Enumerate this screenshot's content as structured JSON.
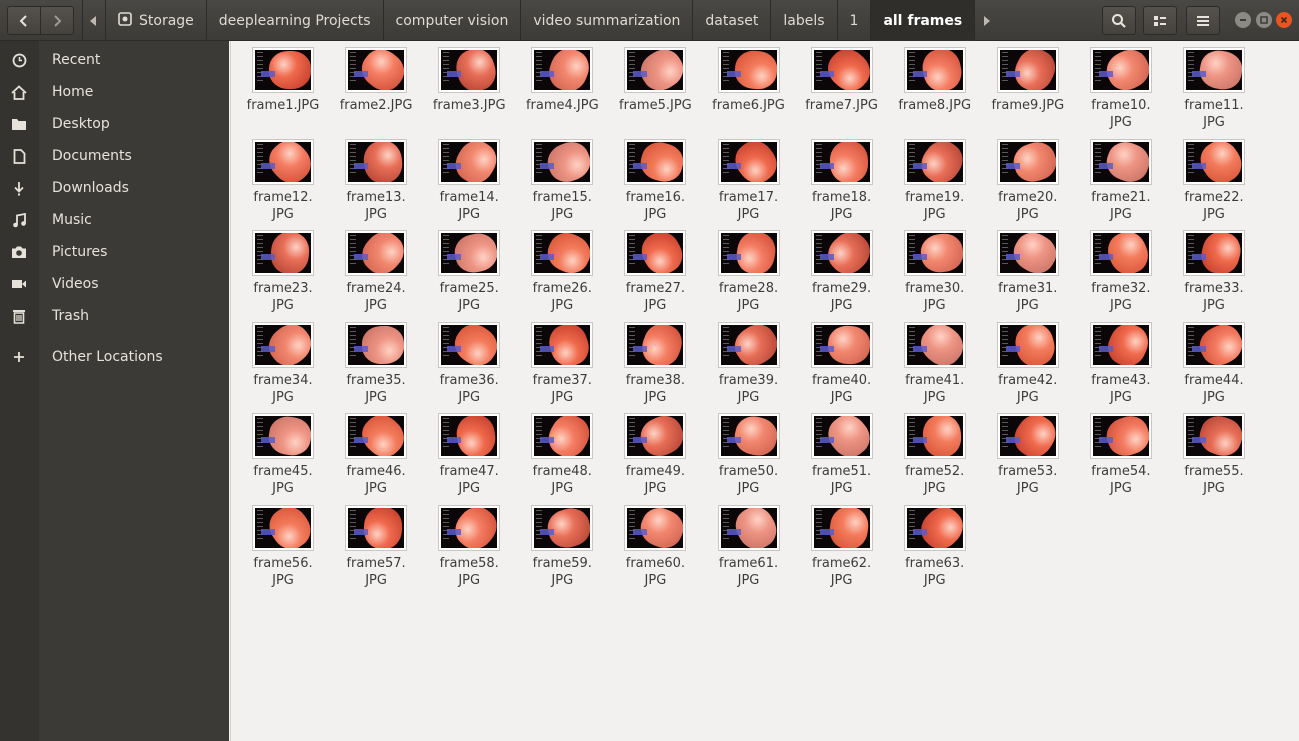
{
  "breadcrumbs": [
    {
      "label": "Storage",
      "icon": "drive-icon"
    },
    {
      "label": "deeplearning Projects"
    },
    {
      "label": "computer vision"
    },
    {
      "label": "video summarization"
    },
    {
      "label": "dataset"
    },
    {
      "label": "labels"
    },
    {
      "label": "1"
    },
    {
      "label": "all frames",
      "active": true
    }
  ],
  "sidebar": {
    "items": [
      {
        "label": "Recent",
        "icon": "clock-icon"
      },
      {
        "label": "Home",
        "icon": "home-icon"
      },
      {
        "label": "Desktop",
        "icon": "folder-icon"
      },
      {
        "label": "Documents",
        "icon": "document-icon"
      },
      {
        "label": "Downloads",
        "icon": "download-icon"
      },
      {
        "label": "Music",
        "icon": "music-icon"
      },
      {
        "label": "Pictures",
        "icon": "camera-icon"
      },
      {
        "label": "Videos",
        "icon": "video-icon"
      },
      {
        "label": "Trash",
        "icon": "trash-icon"
      },
      {
        "label": "Other Locations",
        "icon": "plus-icon"
      }
    ]
  },
  "colors": {
    "header_bg": "#3d3b37",
    "sidebar_bg": "#3b3a37",
    "content_bg": "#f2f1f0",
    "close_button": "#e95420",
    "window_button": "#8b8a85"
  },
  "files": [
    {
      "line1": "frame1.JPG",
      "line2": ""
    },
    {
      "line1": "frame2.JPG",
      "line2": ""
    },
    {
      "line1": "frame3.JPG",
      "line2": ""
    },
    {
      "line1": "frame4.JPG",
      "line2": ""
    },
    {
      "line1": "frame5.JPG",
      "line2": ""
    },
    {
      "line1": "frame6.JPG",
      "line2": ""
    },
    {
      "line1": "frame7.JPG",
      "line2": ""
    },
    {
      "line1": "frame8.JPG",
      "line2": ""
    },
    {
      "line1": "frame9.JPG",
      "line2": ""
    },
    {
      "line1": "frame10.",
      "line2": "JPG"
    },
    {
      "line1": "frame11.",
      "line2": "JPG"
    },
    {
      "line1": "frame12.",
      "line2": "JPG"
    },
    {
      "line1": "frame13.",
      "line2": "JPG"
    },
    {
      "line1": "frame14.",
      "line2": "JPG"
    },
    {
      "line1": "frame15.",
      "line2": "JPG"
    },
    {
      "line1": "frame16.",
      "line2": "JPG"
    },
    {
      "line1": "frame17.",
      "line2": "JPG"
    },
    {
      "line1": "frame18.",
      "line2": "JPG"
    },
    {
      "line1": "frame19.",
      "line2": "JPG"
    },
    {
      "line1": "frame20.",
      "line2": "JPG"
    },
    {
      "line1": "frame21.",
      "line2": "JPG"
    },
    {
      "line1": "frame22.",
      "line2": "JPG"
    },
    {
      "line1": "frame23.",
      "line2": "JPG"
    },
    {
      "line1": "frame24.",
      "line2": "JPG"
    },
    {
      "line1": "frame25.",
      "line2": "JPG"
    },
    {
      "line1": "frame26.",
      "line2": "JPG"
    },
    {
      "line1": "frame27.",
      "line2": "JPG"
    },
    {
      "line1": "frame28.",
      "line2": "JPG"
    },
    {
      "line1": "frame29.",
      "line2": "JPG"
    },
    {
      "line1": "frame30.",
      "line2": "JPG"
    },
    {
      "line1": "frame31.",
      "line2": "JPG"
    },
    {
      "line1": "frame32.",
      "line2": "JPG"
    },
    {
      "line1": "frame33.",
      "line2": "JPG"
    },
    {
      "line1": "frame34.",
      "line2": "JPG"
    },
    {
      "line1": "frame35.",
      "line2": "JPG"
    },
    {
      "line1": "frame36.",
      "line2": "JPG"
    },
    {
      "line1": "frame37.",
      "line2": "JPG"
    },
    {
      "line1": "frame38.",
      "line2": "JPG"
    },
    {
      "line1": "frame39.",
      "line2": "JPG"
    },
    {
      "line1": "frame40.",
      "line2": "JPG"
    },
    {
      "line1": "frame41.",
      "line2": "JPG"
    },
    {
      "line1": "frame42.",
      "line2": "JPG"
    },
    {
      "line1": "frame43.",
      "line2": "JPG"
    },
    {
      "line1": "frame44.",
      "line2": "JPG"
    },
    {
      "line1": "frame45.",
      "line2": "JPG"
    },
    {
      "line1": "frame46.",
      "line2": "JPG"
    },
    {
      "line1": "frame47.",
      "line2": "JPG"
    },
    {
      "line1": "frame48.",
      "line2": "JPG"
    },
    {
      "line1": "frame49.",
      "line2": "JPG"
    },
    {
      "line1": "frame50.",
      "line2": "JPG"
    },
    {
      "line1": "frame51.",
      "line2": "JPG"
    },
    {
      "line1": "frame52.",
      "line2": "JPG"
    },
    {
      "line1": "frame53.",
      "line2": "JPG"
    },
    {
      "line1": "frame54.",
      "line2": "JPG"
    },
    {
      "line1": "frame55.",
      "line2": "JPG"
    },
    {
      "line1": "frame56.",
      "line2": "JPG"
    },
    {
      "line1": "frame57.",
      "line2": "JPG"
    },
    {
      "line1": "frame58.",
      "line2": "JPG"
    },
    {
      "line1": "frame59.",
      "line2": "JPG"
    },
    {
      "line1": "frame60.",
      "line2": "JPG"
    },
    {
      "line1": "frame61.",
      "line2": "JPG"
    },
    {
      "line1": "frame62.",
      "line2": "JPG"
    },
    {
      "line1": "frame63.",
      "line2": "JPG"
    }
  ]
}
